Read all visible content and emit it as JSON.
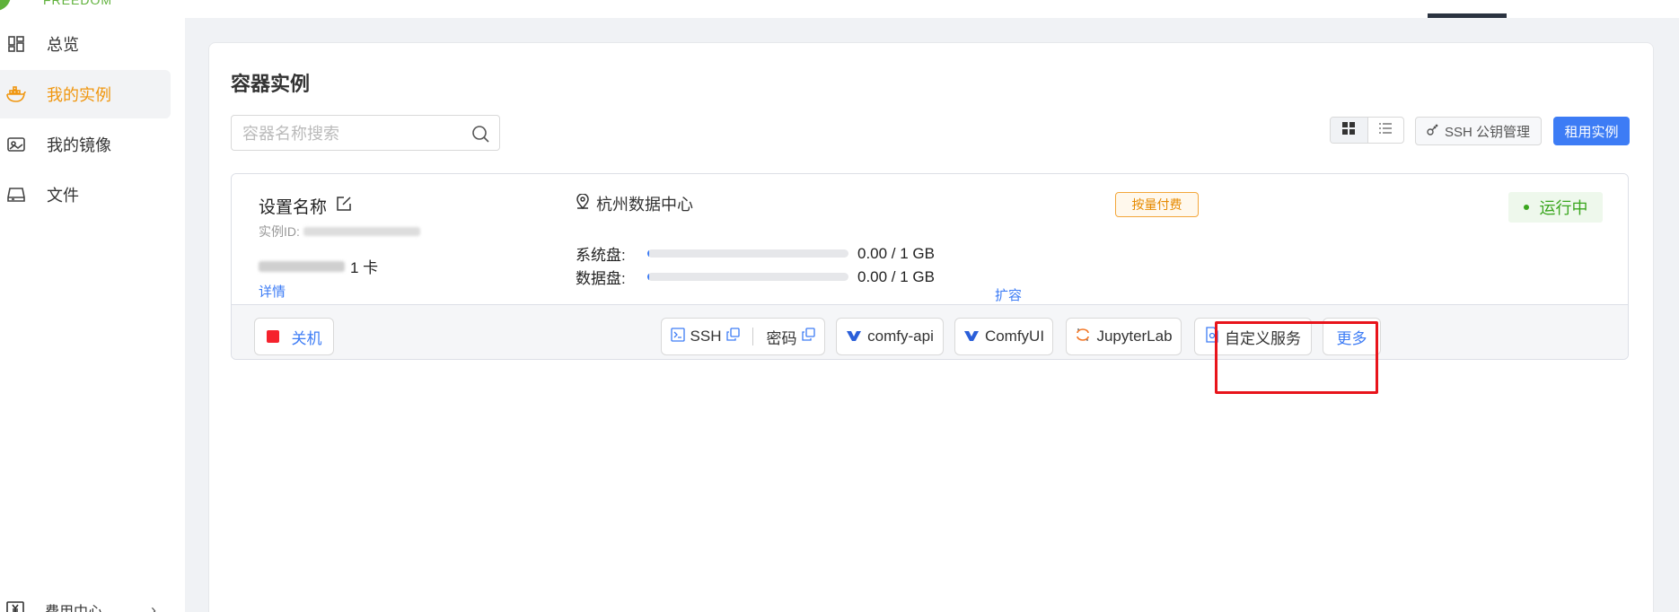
{
  "topbar": {
    "logo_text": "FREEDOM"
  },
  "sidebar": {
    "items": [
      {
        "label": "总览",
        "icon": "dashboard-icon"
      },
      {
        "label": "我的实例",
        "icon": "docker-icon"
      },
      {
        "label": "我的镜像",
        "icon": "image-icon"
      },
      {
        "label": "文件",
        "icon": "storage-icon"
      }
    ],
    "billing": {
      "label": "费用中心",
      "icon": "yen-icon"
    }
  },
  "main": {
    "title": "容器实例",
    "search": {
      "placeholder": "容器名称搜索",
      "value": ""
    },
    "ssh_key_label": "SSH 公钥管理",
    "rent_label": "租用实例"
  },
  "instance": {
    "name": "设置名称",
    "id_label": "实例ID:",
    "gpu_count": "1 卡",
    "detail_label": "详情",
    "datacenter": "杭州数据中心",
    "billing_tag": "按量付费",
    "status": "运行中",
    "system_disk": {
      "label": "系统盘:",
      "value": "0.00 / 1 GB",
      "fraction": 0.01
    },
    "data_disk": {
      "label": "数据盘:",
      "value": "0.00 / 1 GB",
      "fraction": 0.01
    },
    "expand_label": "扩容",
    "actions": {
      "shutdown": "关机",
      "ssh": "SSH",
      "password": "密码",
      "comfy_api": "comfy-api",
      "comfyui": "ComfyUI",
      "jupyterlab": "JupyterLab",
      "custom_service": "自定义服务",
      "more": "更多"
    }
  },
  "colors": {
    "accent": "#3d7cf5",
    "active_nav": "#f0960e",
    "status_green": "#3aa61e",
    "highlight_red": "#e8141b"
  }
}
